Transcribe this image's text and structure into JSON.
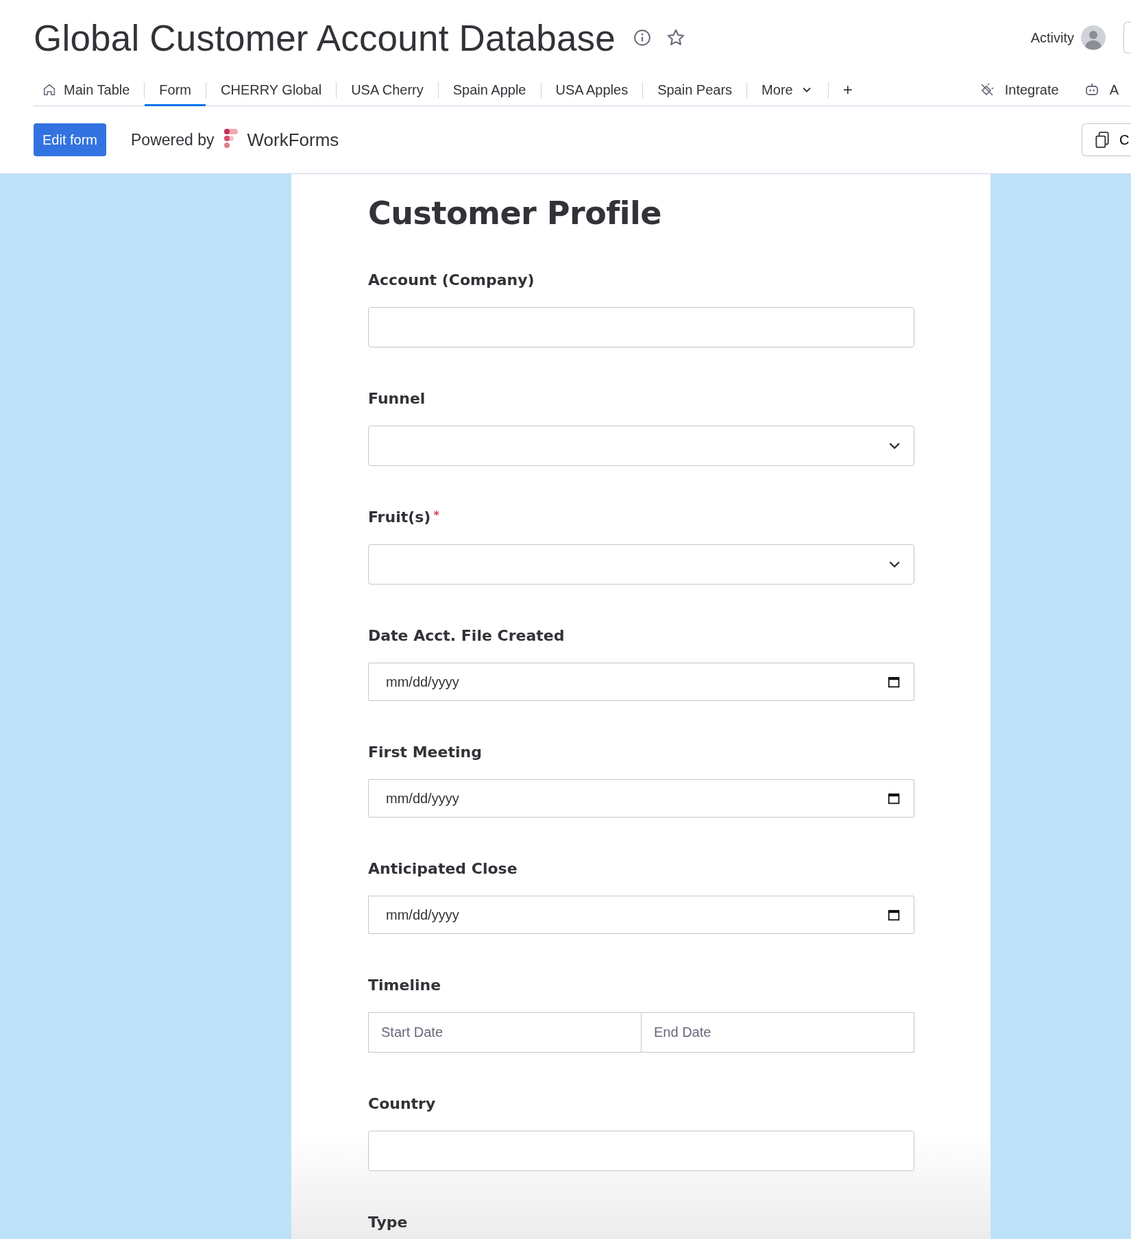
{
  "board": {
    "title": "Global Customer Account Database",
    "activity_label": "Activity"
  },
  "tabs": [
    {
      "label": "Main Table",
      "selected": false
    },
    {
      "label": "Form",
      "selected": true
    },
    {
      "label": "CHERRY Global",
      "selected": false
    },
    {
      "label": "USA Cherry",
      "selected": false
    },
    {
      "label": "Spain Apple",
      "selected": false
    },
    {
      "label": "USA Apples",
      "selected": false
    },
    {
      "label": "Spain Pears",
      "selected": false
    }
  ],
  "more_tab": "More",
  "add_tab": "+",
  "right_actions": [
    {
      "label": "Integrate",
      "kind": "integrate"
    },
    {
      "label": "A",
      "kind": "automate"
    }
  ],
  "toolbar": {
    "edit_button": "Edit form",
    "powered_by": "Powered by",
    "brand": "WorkForms",
    "copy_button": "C"
  },
  "form": {
    "title": "Customer Profile",
    "required_marker": "*",
    "fields": [
      {
        "label": "Account (Company)",
        "kind": "text",
        "required": false
      },
      {
        "label": "Funnel",
        "kind": "select",
        "required": false
      },
      {
        "label": "Fruit(s)",
        "kind": "select",
        "required": true
      },
      {
        "label": "Date Acct. File Created",
        "kind": "date",
        "required": false,
        "placeholder": "mm/dd/yyyy"
      },
      {
        "label": "First Meeting",
        "kind": "date",
        "required": false,
        "placeholder": "mm/dd/yyyy"
      },
      {
        "label": "Anticipated Close",
        "kind": "date",
        "required": false,
        "placeholder": "mm/dd/yyyy"
      },
      {
        "label": "Timeline",
        "kind": "daterange",
        "required": false,
        "start_placeholder": "Start Date",
        "end_placeholder": "End Date"
      },
      {
        "label": "Country",
        "kind": "text",
        "required": false
      },
      {
        "label": "Type",
        "kind": "none",
        "required": false
      }
    ]
  }
}
